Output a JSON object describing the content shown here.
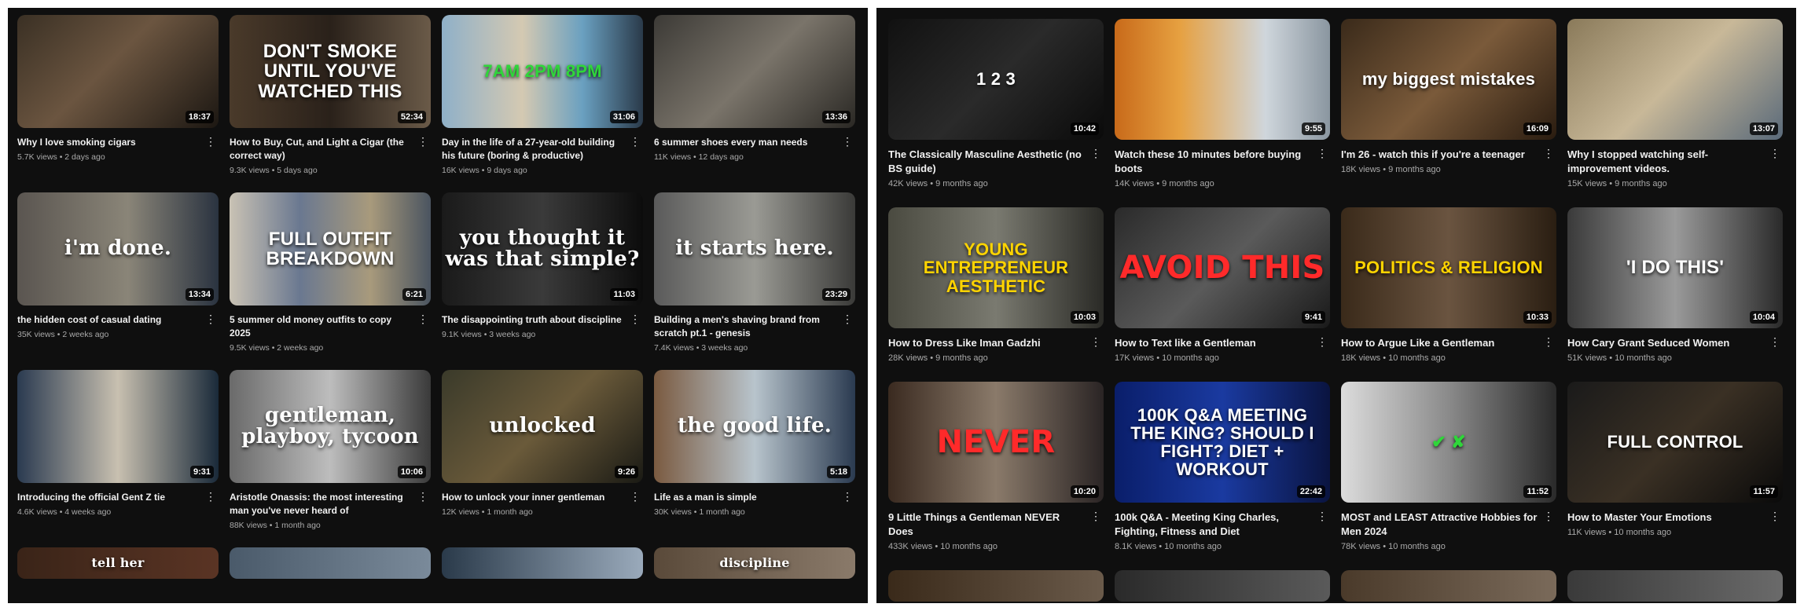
{
  "left": {
    "videos": [
      {
        "title": "Why I love smoking cigars",
        "views": "5.7K views",
        "age": "2 days ago",
        "duration": "18:37",
        "overlay": "",
        "fx": "",
        "bg": "linear-gradient(135deg,#3a3024,#6b5540 45%,#1c1712)"
      },
      {
        "title": "How to Buy, Cut, and Light a Cigar (the correct way)",
        "views": "9.3K views",
        "age": "5 days ago",
        "duration": "52:34",
        "overlay": "DON'T SMOKE UNTIL YOU'VE WATCHED THIS",
        "fx": "fx-outline",
        "bg": "linear-gradient(90deg,#4a3a2a,#2a211a 50%,#6a5a48)"
      },
      {
        "title": "Day in the life of a 27-year-old building his future (boring & productive)",
        "views": "16K views",
        "age": "9 days ago",
        "duration": "31:06",
        "overlay": "7AM   2PM   8PM",
        "fx": "fx-green",
        "bg": "linear-gradient(90deg,#8fb0c8,#d4c9b2 40%,#6aa0c0 70%,#2a3a4a)"
      },
      {
        "title": "6 summer shoes every man needs",
        "views": "11K views",
        "age": "12 days ago",
        "duration": "13:36",
        "overlay": "",
        "fx": "",
        "bg": "linear-gradient(135deg,#3c3a36,#7a746a 50%,#2a2824)"
      },
      {
        "title": "the hidden cost of casual dating",
        "views": "35K views",
        "age": "2 weeks ago",
        "duration": "13:34",
        "overlay": "i'm done.",
        "fx": "fx-serif",
        "bg": "linear-gradient(90deg,#5a5550,#8a8578 55%,#2a3340)"
      },
      {
        "title": "5 summer old money outfits to copy 2025",
        "views": "9.5K views",
        "age": "2 weeks ago",
        "duration": "6:21",
        "overlay": "FULL OUTFIT BREAKDOWN",
        "fx": "fx-outline",
        "bg": "linear-gradient(90deg,#c9c2b4,#6a7890 35%,#a89a7c 70%,#4a5460)"
      },
      {
        "title": "The disappointing truth about discipline",
        "views": "9.1K views",
        "age": "3 weeks ago",
        "duration": "11:03",
        "overlay": "you thought it was that simple?",
        "fx": "fx-serif",
        "bg": "linear-gradient(90deg,#1a1a1a,#3a3a3a 50%,#0c0c0c)"
      },
      {
        "title": "Building a men's shaving brand from scratch pt.1 - genesis",
        "views": "7.4K views",
        "age": "3 weeks ago",
        "duration": "23:29",
        "overlay": "it starts here.",
        "fx": "fx-serif",
        "bg": "linear-gradient(90deg,#5a5a5a,#9a9a94 50%,#3a3a38)"
      },
      {
        "title": "Introducing the official Gent Z tie",
        "views": "4.6K views",
        "age": "4 weeks ago",
        "duration": "9:31",
        "overlay": "",
        "fx": "",
        "bg": "linear-gradient(90deg,#2a3a50,#c8c0b0 50%,#1a2a3a)"
      },
      {
        "title": "Aristotle Onassis: the most interesting man you've never heard of",
        "views": "88K views",
        "age": "1 month ago",
        "duration": "10:06",
        "overlay": "gentleman, playboy, tycoon",
        "fx": "fx-serif",
        "bg": "linear-gradient(90deg,#6a6a6a,#bdbdbd 50%,#3a3a3a)"
      },
      {
        "title": "How to unlock your inner gentleman",
        "views": "12K views",
        "age": "1 month ago",
        "duration": "9:26",
        "overlay": "unlocked",
        "fx": "fx-serif",
        "bg": "linear-gradient(135deg,#3a3a2a,#6a5a3a 50%,#1a1a14)"
      },
      {
        "title": "Life as a man is simple",
        "views": "30K views",
        "age": "1 month ago",
        "duration": "5:18",
        "overlay": "the good life.",
        "fx": "fx-serif",
        "bg": "linear-gradient(90deg,#7a5a40,#b8c4cc 50%,#2a3a50)"
      }
    ],
    "partial": [
      {
        "overlay": "tell her",
        "bg": "linear-gradient(90deg,#3a2418,#5a3424)"
      },
      {
        "overlay": "",
        "bg": "linear-gradient(90deg,#4a5a6a,#7a8a9a)"
      },
      {
        "overlay": "",
        "bg": "linear-gradient(90deg,#2a3a4a,#9aaabb)"
      },
      {
        "overlay": "discipline",
        "bg": "linear-gradient(90deg,#5a4a3a,#8a7a6a)"
      }
    ]
  },
  "right": {
    "videos": [
      {
        "title": "The Classically Masculine Aesthetic (no BS guide)",
        "views": "42K views",
        "age": "9 months ago",
        "duration": "10:42",
        "overlay": "1      2      3",
        "fx": "",
        "bg": "linear-gradient(135deg,#111,#2a2a2a 50%,#0a0a0a)"
      },
      {
        "title": "Watch these 10 minutes before buying boots",
        "views": "14K views",
        "age": "9 months ago",
        "duration": "9:55",
        "overlay": "",
        "fx": "",
        "bg": "linear-gradient(90deg,#c86a1a,#e6a040 30%,#cfd6dc 70%,#8a96a0)"
      },
      {
        "title": "I'm 26 - watch this if you're a teenager",
        "views": "18K views",
        "age": "9 months ago",
        "duration": "16:09",
        "overlay": "my biggest mistakes",
        "fx": "",
        "bg": "linear-gradient(135deg,#3a2a1a,#7a5a3a 50%,#2a1c10)"
      },
      {
        "title": "Why I stopped watching self-improvement videos.",
        "views": "15K views",
        "age": "9 months ago",
        "duration": "13:07",
        "overlay": "",
        "fx": "",
        "bg": "linear-gradient(135deg,#8a7a5a,#c8b898 50%,#5a6a7a)"
      },
      {
        "title": "How to Dress Like Iman Gadzhi",
        "views": "28K views",
        "age": "9 months ago",
        "duration": "10:03",
        "overlay": "YOUNG ENTREPRENEUR AESTHETIC",
        "fx": "fx-yellow",
        "bg": "linear-gradient(90deg,#4a4a40,#7a7a70 50%,#2a2a26)"
      },
      {
        "title": "How to Text like a Gentleman",
        "views": "17K views",
        "age": "10 months ago",
        "duration": "9:41",
        "overlay": "AVOID THIS",
        "fx": "fx-red",
        "bg": "linear-gradient(135deg,#2a2a2a,#5a5a5a 50%,#1a1a1a)"
      },
      {
        "title": "How to Argue Like a Gentleman",
        "views": "18K views",
        "age": "10 months ago",
        "duration": "10:33",
        "overlay": "POLITICS & RELIGION",
        "fx": "fx-yellow",
        "bg": "linear-gradient(90deg,#3a2a1a,#6a5440 50%,#2a1e12)"
      },
      {
        "title": "How Cary Grant Seduced Women",
        "views": "51K views",
        "age": "10 months ago",
        "duration": "10:04",
        "overlay": "'I DO THIS'",
        "fx": "fx-outline",
        "bg": "linear-gradient(90deg,#3a3a3a,#9a9a9a 50%,#2a2a2a)"
      },
      {
        "title": "9 Little Things a Gentleman NEVER Does",
        "views": "433K views",
        "age": "10 months ago",
        "duration": "10:20",
        "overlay": "NEVER",
        "fx": "fx-red",
        "bg": "linear-gradient(90deg,#3a2a20,#8a7a6a 50%,#2a2424)"
      },
      {
        "title": "100k Q&A - Meeting King Charles, Fighting, Fitness and Diet",
        "views": "8.1K views",
        "age": "10 months ago",
        "duration": "22:42",
        "overlay": "100K Q&A   MEETING THE KING? SHOULD I FIGHT? DIET + WORKOUT",
        "fx": "",
        "bg": "linear-gradient(90deg,#0a1e6a,#1a3aa0 50%,#0a1440)"
      },
      {
        "title": "MOST and LEAST Attractive Hobbies for Men 2024",
        "views": "78K views",
        "age": "10 months ago",
        "duration": "11:52",
        "overlay": "✔        ✘",
        "fx": "fx-green",
        "bg": "linear-gradient(90deg,#dcdcdc,#8a8a8a 50%,#2a2a2a)"
      },
      {
        "title": "How to Master Your Emotions",
        "views": "11K views",
        "age": "10 months ago",
        "duration": "11:57",
        "overlay": "FULL CONTROL",
        "fx": "",
        "bg": "linear-gradient(135deg,#1a1a1a,#3a3024 50%,#0a0a0a)"
      }
    ],
    "partial": [
      {
        "overlay": "",
        "bg": "linear-gradient(90deg,#3a2a1a,#6a5a4a)"
      },
      {
        "overlay": "",
        "bg": "linear-gradient(90deg,#2a2a2a,#5a5a5a)"
      },
      {
        "overlay": "",
        "bg": "linear-gradient(90deg,#4a3a2a,#7a6a5a)"
      },
      {
        "overlay": "",
        "bg": "linear-gradient(90deg,#3a3a3a,#6a6a6a)"
      }
    ]
  },
  "ui": {
    "more_glyph": "⋮",
    "separator": " • "
  }
}
